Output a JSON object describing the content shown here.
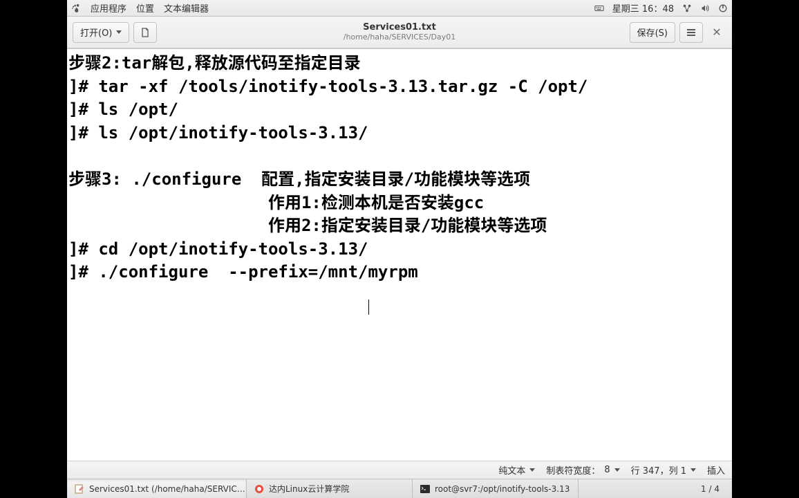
{
  "top_panel": {
    "apps_label": "应用程序",
    "places_label": "位置",
    "textedit_label": "文本编辑器",
    "clock": "星期三 16：48"
  },
  "window": {
    "open_label": "打开(O)",
    "save_label": "保存(S)",
    "filename": "Services01.txt",
    "filepath": "/home/haha/SERVICES/Day01"
  },
  "editor": {
    "lines": [
      "步骤2:tar解包,释放源代码至指定目录",
      "]# tar -xf /tools/inotify-tools-3.13.tar.gz -C /opt/",
      "]# ls /opt/",
      "]# ls /opt/inotify-tools-3.13/",
      "",
      "步骤3: ./configure  配置,指定安装目录/功能模块等选项",
      "                    作用1:检测本机是否安装gcc",
      "                    作用2:指定安装目录/功能模块等选项",
      "]# cd /opt/inotify-tools-3.13/",
      "]# ./configure  --prefix=/mnt/myrpm"
    ]
  },
  "statusbar": {
    "syntax": "纯文本",
    "tab_width_label": "制表符宽度：",
    "tab_width_value": "8",
    "cursor_pos": "行 347，列 1",
    "insert_mode": "插入"
  },
  "taskbar": {
    "items": [
      {
        "label": "Services01.txt (/home/haha/SERVIC…"
      },
      {
        "label": "达内Linux云计算学院"
      },
      {
        "label": "root@svr7:/opt/inotify-tools-3.13"
      }
    ],
    "workspace": "1 / 4"
  }
}
